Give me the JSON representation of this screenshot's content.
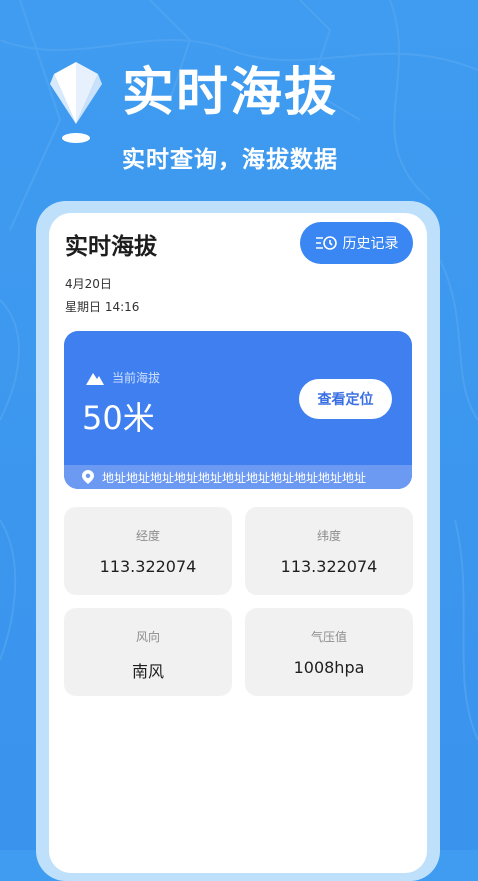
{
  "hero": {
    "title": "实时海拔",
    "subtitle": "实时查询，海拔数据"
  },
  "card": {
    "title": "实时海拔",
    "history_button": "历史记录",
    "date": "4月20日",
    "weekday_time": "星期日 14:16"
  },
  "altitude": {
    "label": "当前海拔",
    "value": "50米",
    "locate_button": "查看定位",
    "address": "地址地址地址地址地址地址地址地址地址地址地址"
  },
  "tiles": {
    "longitude": {
      "label": "经度",
      "value": "113.322074"
    },
    "latitude": {
      "label": "纬度",
      "value": "113.322074"
    },
    "wind": {
      "label": "风向",
      "value": "南风"
    },
    "pressure": {
      "label": "气压值",
      "value": "1008hpa"
    }
  },
  "colors": {
    "background": "#3f9cf0",
    "accent": "#3a86f2",
    "altitude_card": "#3f7fef",
    "tile_bg": "#f1f1f1"
  },
  "icons": {
    "logo": "diamond-pin-icon",
    "history": "history-clock-icon",
    "mountain": "mountain-icon",
    "location": "location-pin-icon"
  }
}
